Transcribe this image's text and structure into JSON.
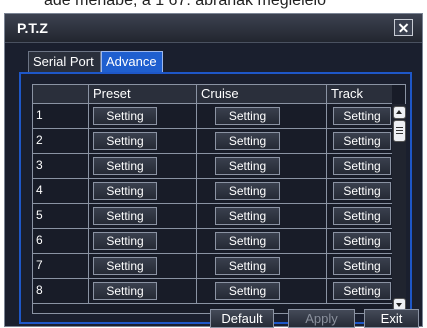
{
  "caption_fragment": "ade mehabe, a 1 67: abranak megielelo",
  "dialog": {
    "title": "P.T.Z",
    "close_icon": "close-x-icon"
  },
  "tabs": [
    {
      "label": "Serial Port",
      "active": false
    },
    {
      "label": "Advance",
      "active": true
    }
  ],
  "table": {
    "headers": [
      "",
      "Preset",
      "Cruise",
      "Track"
    ],
    "rows": [
      {
        "num": "1",
        "preset": "Setting",
        "cruise": "Setting",
        "track": "Setting"
      },
      {
        "num": "2",
        "preset": "Setting",
        "cruise": "Setting",
        "track": "Setting"
      },
      {
        "num": "3",
        "preset": "Setting",
        "cruise": "Setting",
        "track": "Setting"
      },
      {
        "num": "4",
        "preset": "Setting",
        "cruise": "Setting",
        "track": "Setting"
      },
      {
        "num": "5",
        "preset": "Setting",
        "cruise": "Setting",
        "track": "Setting"
      },
      {
        "num": "6",
        "preset": "Setting",
        "cruise": "Setting",
        "track": "Setting"
      },
      {
        "num": "7",
        "preset": "Setting",
        "cruise": "Setting",
        "track": "Setting"
      },
      {
        "num": "8",
        "preset": "Setting",
        "cruise": "Setting",
        "track": "Setting"
      }
    ]
  },
  "footer": {
    "default_label": "Default",
    "apply_label": "Apply",
    "exit_label": "Exit"
  },
  "colors": {
    "accent": "#1e57c8",
    "background": "#1a1f2e"
  }
}
